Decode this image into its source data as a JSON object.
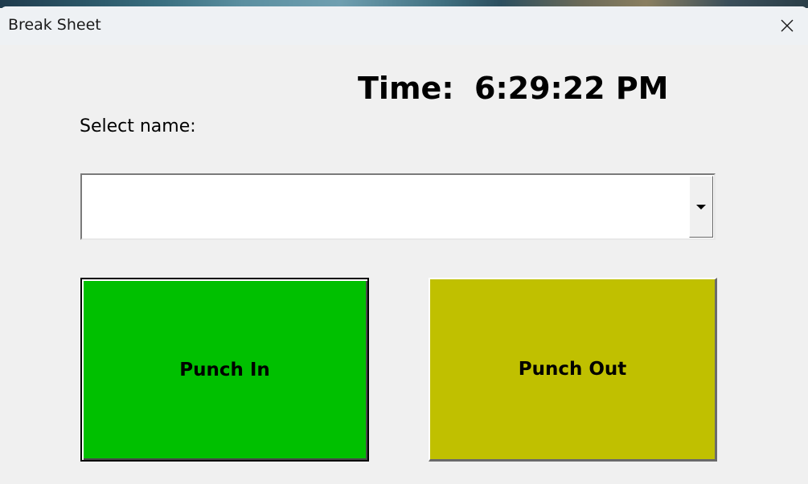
{
  "window": {
    "title": "Break Sheet",
    "close_icon": "close-icon"
  },
  "clock": {
    "label": "Time:",
    "value": "6:29:22 PM"
  },
  "name_select": {
    "label": "Select name:",
    "value": "",
    "arrow_icon": "chevron-down-icon"
  },
  "buttons": {
    "punch_in": {
      "label": "Punch In",
      "color": "#00c000"
    },
    "punch_out": {
      "label": "Punch Out",
      "color": "#c0c000"
    }
  }
}
